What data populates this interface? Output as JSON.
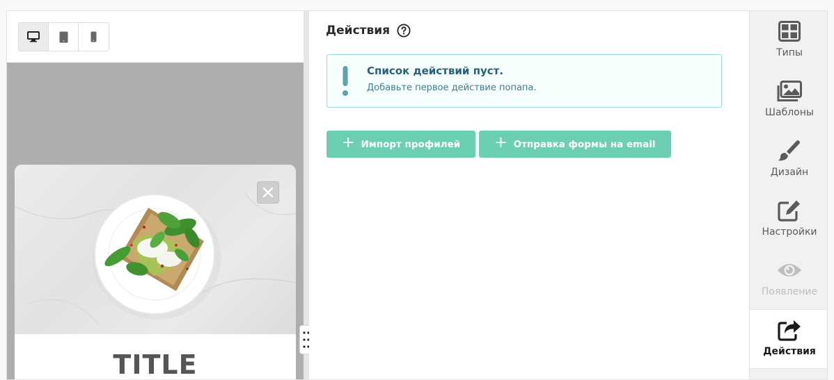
{
  "preview": {
    "devices": [
      {
        "name": "desktop",
        "icon": "monitor-icon",
        "active": true
      },
      {
        "name": "tablet",
        "icon": "tablet-icon",
        "active": false
      },
      {
        "name": "mobile",
        "icon": "phone-icon",
        "active": false
      }
    ],
    "popup": {
      "title": "TITLE",
      "close_icon": "close-icon",
      "image_icon": "food-plate-image"
    }
  },
  "actions": {
    "title": "Действия",
    "help_icon": "question-circle-icon",
    "empty_alert": {
      "icon": "exclamation-icon",
      "title": "Список действий пуст.",
      "text": "Добавьте первое действие попапа."
    },
    "buttons": [
      {
        "label": "Импорт профилей",
        "icon": "plus-icon"
      },
      {
        "label": "Отправка формы на email",
        "icon": "plus-icon"
      }
    ]
  },
  "sidenav": {
    "items": [
      {
        "label": "Типы",
        "icon": "grid-icon",
        "state": "normal"
      },
      {
        "label": "Шаблоны",
        "icon": "images-icon",
        "state": "normal"
      },
      {
        "label": "Дизайн",
        "icon": "brush-icon",
        "state": "normal"
      },
      {
        "label": "Настройки",
        "icon": "edit-icon",
        "state": "normal"
      },
      {
        "label": "Появление",
        "icon": "eye-icon",
        "state": "disabled"
      },
      {
        "label": "Действия",
        "icon": "share-icon",
        "state": "active"
      }
    ]
  },
  "colors": {
    "accent": "#6ccfb1",
    "alert_border": "#9fd6d9",
    "alert_bg": "#f5fdfd",
    "alert_title": "#27607b"
  }
}
